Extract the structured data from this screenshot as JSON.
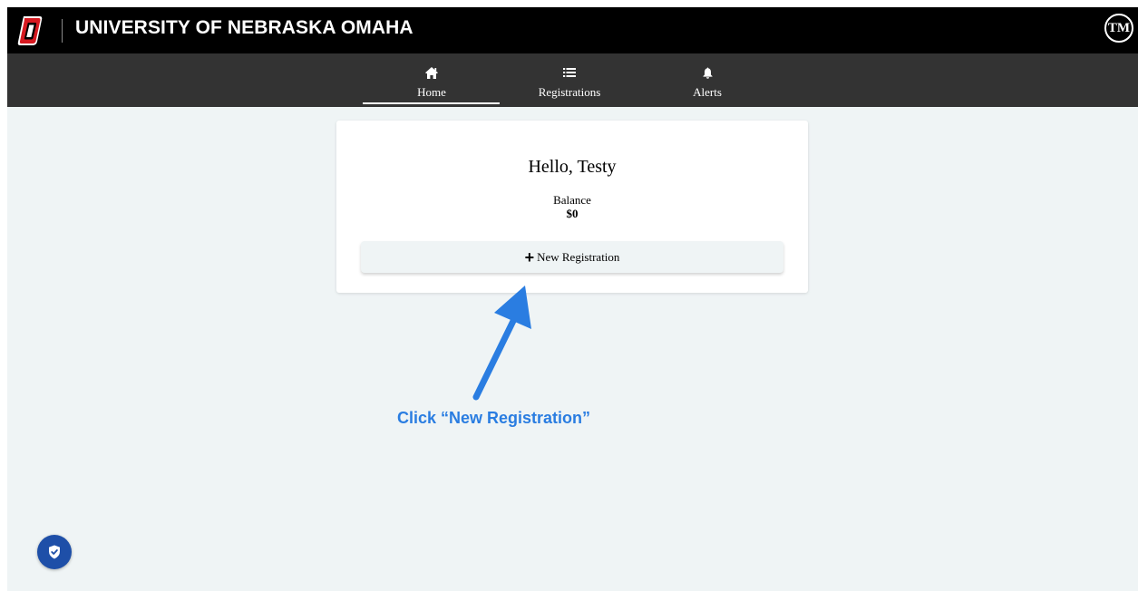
{
  "header": {
    "logo_text": "UNIVERSITY OF NEBRASKA OMAHA",
    "avatar_initials": "TM",
    "logo_icon": "uno-o-logo"
  },
  "nav": {
    "items": [
      {
        "label": "Home",
        "icon": "home-icon",
        "active": true
      },
      {
        "label": "Registrations",
        "icon": "list-icon",
        "active": false
      },
      {
        "label": "Alerts",
        "icon": "bell-icon",
        "active": false
      }
    ]
  },
  "card": {
    "greeting": "Hello, Testy",
    "balance_label": "Balance",
    "balance_value": "$0",
    "new_registration_label": "New Registration"
  },
  "annotation": {
    "text": "Click “New Registration”"
  },
  "floating": {
    "icon": "shield-check-icon"
  },
  "colors": {
    "topbar": "#000000",
    "navbar": "#333333",
    "page_bg": "#eff4f5",
    "accent_blue": "#2a7de1",
    "fab_blue": "#1e4fa8",
    "logo_red": "#d71920"
  }
}
